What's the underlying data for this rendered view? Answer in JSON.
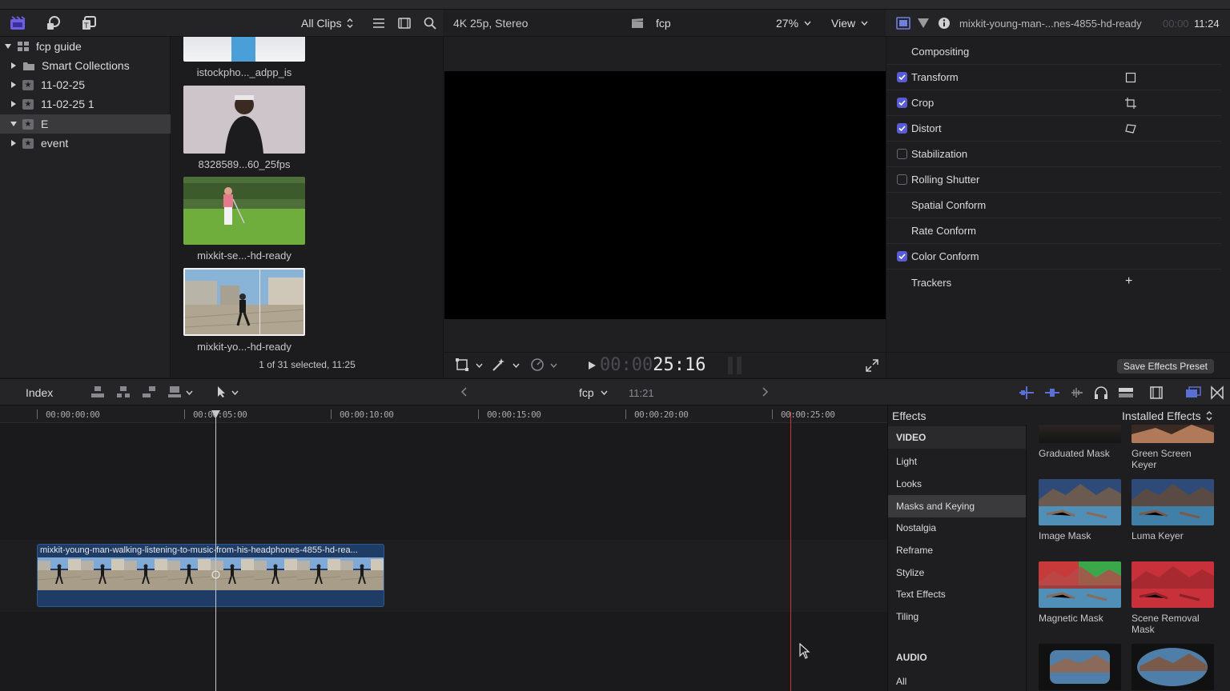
{
  "library": {
    "title": "fcp guide",
    "items": [
      {
        "label": "Smart Collections",
        "type": "folder"
      },
      {
        "label": "11-02-25",
        "type": "event"
      },
      {
        "label": "11-02-25 1",
        "type": "event"
      },
      {
        "label": "E",
        "type": "event",
        "selected": true
      },
      {
        "label": "event",
        "type": "event"
      }
    ]
  },
  "browser": {
    "filter": "All Clips",
    "clips": [
      {
        "label": "istockpho..._adpp_is"
      },
      {
        "label": "8328589...60_25fps"
      },
      {
        "label": "mixkit-se...-hd-ready"
      },
      {
        "label": "mixkit-yo...-hd-ready",
        "selected": true
      }
    ],
    "status": "1 of 31 selected, 11:25"
  },
  "viewer": {
    "format": "4K 25p, Stereo",
    "project": "fcp",
    "zoom": "27%",
    "view_label": "View",
    "timecode_dim": "00:00",
    "timecode": "25:16"
  },
  "inspector": {
    "clip_name": "mixkit-young-man-...nes-4855-hd-ready",
    "time_dim": "00:00",
    "time": "11:24",
    "rows": [
      {
        "label": "Compositing",
        "check": null
      },
      {
        "label": "Transform",
        "check": true
      },
      {
        "label": "Crop",
        "check": true
      },
      {
        "label": "Distort",
        "check": true
      },
      {
        "label": "Stabilization",
        "check": false
      },
      {
        "label": "Rolling Shutter",
        "check": false
      },
      {
        "label": "Spatial Conform",
        "check": null
      },
      {
        "label": "Rate Conform",
        "check": null
      },
      {
        "label": "Color Conform",
        "check": true
      },
      {
        "label": "Trackers",
        "check": null
      }
    ],
    "add_glyph": "+",
    "save_preset": "Save Effects Preset"
  },
  "timeline": {
    "index_label": "Index",
    "project": "fcp",
    "duration": "11:21",
    "ruler": [
      "00:00:00:00",
      "00:00:05:00",
      "00:00:10:00",
      "00:00:15:00",
      "00:00:20:00",
      "00:00:25:00"
    ],
    "clip_title": "mixkit-young-man-walking-listening-to-music-from-his-headphones-4855-hd-rea..."
  },
  "effects": {
    "title": "Effects",
    "filter": "Installed Effects",
    "video_header": "VIDEO",
    "categories": [
      "Light",
      "Looks",
      "Masks and Keying",
      "Nostalgia",
      "Reframe",
      "Stylize",
      "Text Effects",
      "Tiling"
    ],
    "selected_category": "Masks and Keying",
    "audio_header": "AUDIO",
    "audio_all": "All",
    "items": [
      {
        "label": "Graduated Mask"
      },
      {
        "label": "Green Screen Keyer"
      },
      {
        "label": "Image Mask"
      },
      {
        "label": "Luma Keyer"
      },
      {
        "label": "Magnetic Mask"
      },
      {
        "label": "Scene Removal Mask"
      }
    ]
  }
}
